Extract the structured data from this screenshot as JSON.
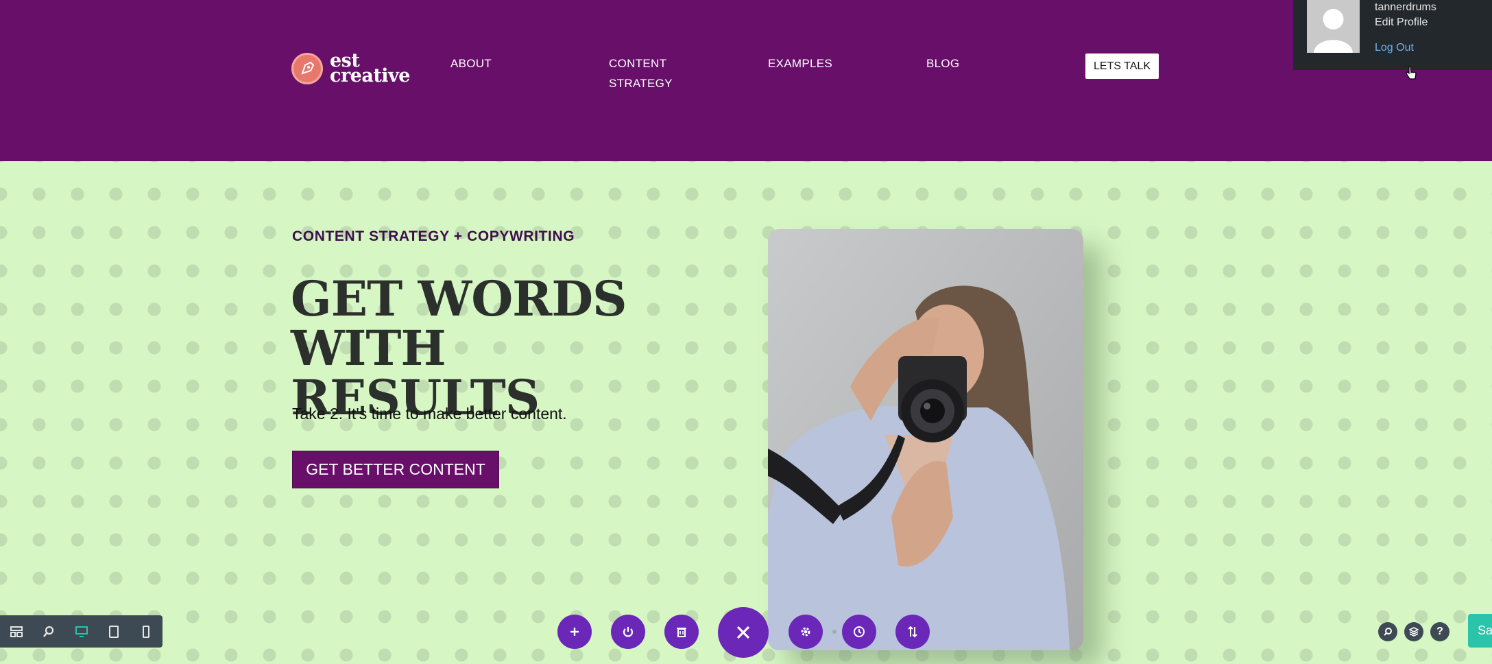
{
  "header": {
    "logo": {
      "line1": "est",
      "line2": "creative"
    },
    "nav": [
      {
        "label": "ABOUT"
      },
      {
        "label": "CONTENT STRATEGY",
        "line1": "CONTENT",
        "line2": "STRATEGY"
      },
      {
        "label": "EXAMPLES"
      },
      {
        "label": "BLOG"
      }
    ],
    "cta_label": "LETS TALK"
  },
  "admin": {
    "username": "tannerdrums",
    "edit_profile": "Edit Profile",
    "logout": "Log Out"
  },
  "hero": {
    "eyebrow": "CONTENT STRATEGY + COPYWRITING",
    "headline_line1": "GET WORDS",
    "headline_line2": "WITH RESULTS",
    "subtext": "Take 2. It's time to make better content.",
    "button_label": "GET BETTER CONTENT"
  },
  "builder": {
    "left_toolbar": [
      "wireframe-icon",
      "zoom-icon",
      "desktop-icon",
      "tablet-icon",
      "phone-icon"
    ],
    "center_actions": [
      "add-icon",
      "power-icon",
      "trash-icon",
      "close-icon",
      "settings-icon",
      "history-icon",
      "portability-icon"
    ],
    "right_actions": [
      "search-icon",
      "layers-icon",
      "help-icon"
    ],
    "save_label": "Sa"
  },
  "colors": {
    "header_bg": "#670f69",
    "hero_bg": "#d6f6c4",
    "builder_accent": "#6a27b8",
    "save_green": "#29c4a9"
  }
}
